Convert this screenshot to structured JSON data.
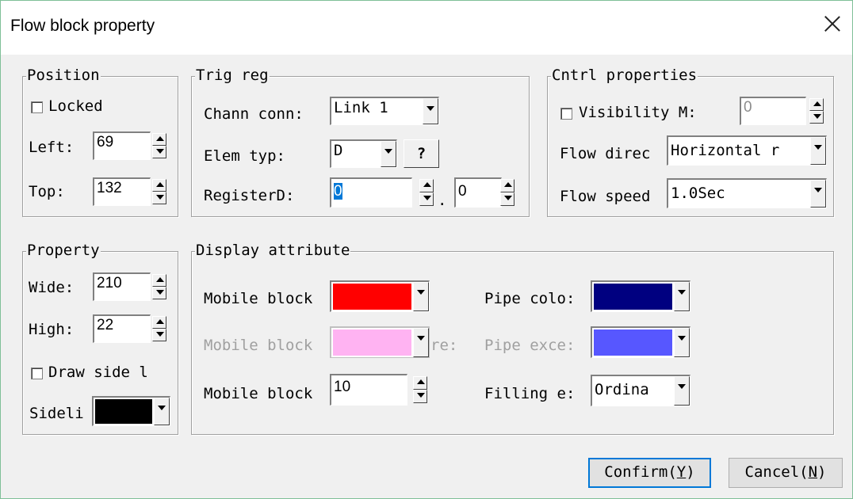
{
  "window": {
    "title": "Flow block property",
    "close_label": "Close"
  },
  "position": {
    "title": "Position",
    "locked_label": "Locked",
    "left_label": "Left:",
    "left_value": "69",
    "top_label": "Top:",
    "top_value": "132"
  },
  "trig_reg": {
    "title": "Trig reg",
    "chann_label": "Chann conn:",
    "chann_value": "Link 1",
    "elem_label": "Elem typ:",
    "elem_value": "D",
    "help_label": "?",
    "register_label": "RegisterD:",
    "register_value": "0",
    "dot": ".",
    "sub_value": "0"
  },
  "cntrl": {
    "title": "Cntrl properties",
    "visibility_label": "Visibility M:",
    "visibility_value": "0",
    "flow_dir_label": "Flow direc",
    "flow_dir_value": "Horizontal r",
    "flow_speed_label": "Flow speed",
    "flow_speed_value": "1.0Sec"
  },
  "property": {
    "title": "Property",
    "wide_label": "Wide:",
    "wide_value": "210",
    "high_label": "High:",
    "high_value": "22",
    "draw_side_label": "Draw side l",
    "sideline_label": "Sideli",
    "sideline_color": "#000000"
  },
  "display": {
    "title": "Display attribute",
    "mobile_block_label": "Mobile block",
    "mobile_block_color": "#ff0000",
    "mobile_block2_label": "Mobile block",
    "mobile_block2_color": "#ffb3f2",
    "mobile_block2_overflow": "re:",
    "mobile_block3_label": "Mobile block",
    "mobile_block3_value": "10",
    "pipe_color_label": "Pipe colo:",
    "pipe_color": "#000080",
    "pipe_exce_label": "Pipe exce:",
    "pipe_exce_color": "#5757ff",
    "filling_label": "Filling e:",
    "filling_value": "Ordina"
  },
  "buttons": {
    "confirm_prefix": "Confirm(",
    "confirm_key": "Y",
    "confirm_suffix": ")",
    "cancel_prefix": "Cancel(",
    "cancel_key": "N",
    "cancel_suffix": ")"
  }
}
